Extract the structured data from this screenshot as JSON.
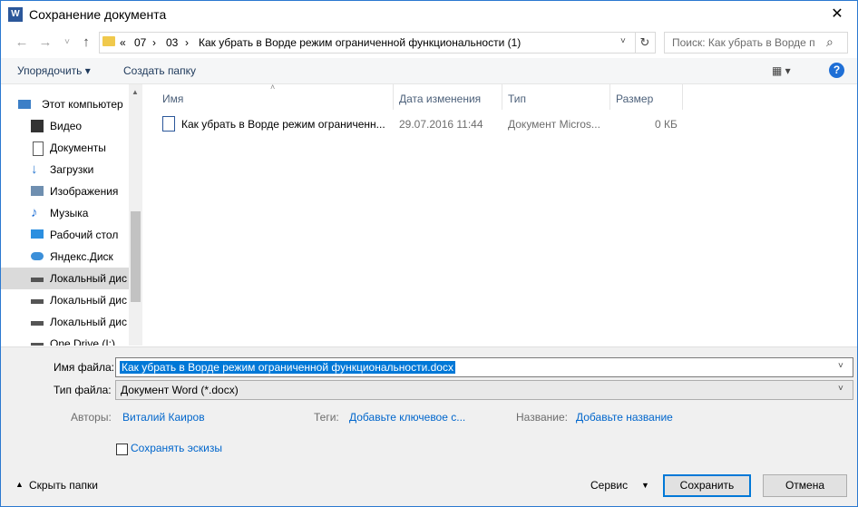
{
  "window": {
    "title": "Сохранение документа",
    "app_icon_letter": "W",
    "close_glyph": "✕"
  },
  "address": {
    "segments": [
      "«",
      "07",
      "›",
      "03",
      "›",
      "Как убрать в Ворде режим ограниченной функциональности (1)"
    ]
  },
  "search": {
    "placeholder": "Поиск: Как убрать в Ворде п"
  },
  "toolbar": {
    "organize": "Упорядочить ▾",
    "new_folder": "Создать папку",
    "view_glyph": "▦ ▾",
    "help": "?"
  },
  "nav": {
    "items": [
      {
        "label": "Этот компьютер",
        "icon": "computer-icon"
      },
      {
        "label": "Видео",
        "icon": "video-icon"
      },
      {
        "label": "Документы",
        "icon": "documents-icon"
      },
      {
        "label": "Загрузки",
        "icon": "downloads-icon"
      },
      {
        "label": "Изображения",
        "icon": "images-icon"
      },
      {
        "label": "Музыка",
        "icon": "music-icon"
      },
      {
        "label": "Рабочий стол",
        "icon": "desktop-icon"
      },
      {
        "label": "Яндекс.Диск",
        "icon": "cloud-icon"
      },
      {
        "label": "Локальный дис",
        "icon": "drive-icon"
      },
      {
        "label": "Локальный дис",
        "icon": "drive-icon"
      },
      {
        "label": "Локальный дис",
        "icon": "drive-icon"
      },
      {
        "label": "One Drive (I:)",
        "icon": "drive-icon"
      }
    ]
  },
  "list": {
    "columns": [
      "Имя",
      "Дата изменения",
      "Тип",
      "Размер"
    ],
    "rows": [
      {
        "name": "Как убрать в Ворде режим ограниченн...",
        "date": "29.07.2016 11:44",
        "type": "Документ Micros...",
        "size": "0 КБ"
      }
    ]
  },
  "form": {
    "filename_label": "Имя файла:",
    "filename_value": "Как убрать в Ворде режим ограниченной функциональности.docx",
    "filetype_label": "Тип файла:",
    "filetype_value": "Документ Word (*.docx)",
    "authors_label": "Авторы:",
    "authors_value": "Виталий Каиров",
    "tags_label": "Теги:",
    "tags_value": "Добавьте ключевое с...",
    "title_label": "Название:",
    "title_value": "Добавьте название",
    "thumbnails_label": "Сохранять эскизы"
  },
  "footer": {
    "hide_folders": "Скрыть папки",
    "service": "Сервис",
    "save": "Сохранить",
    "cancel": "Отмена"
  }
}
